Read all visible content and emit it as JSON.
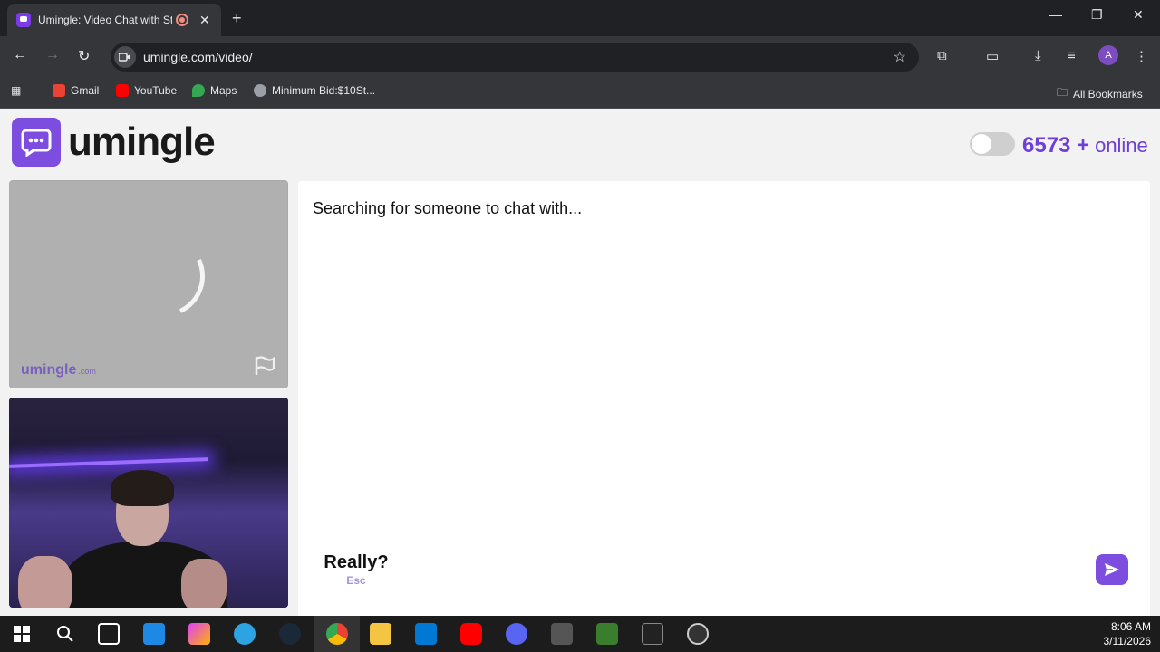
{
  "browser": {
    "tab_title": "Umingle: Video Chat with Strangers",
    "url": "umingle.com/video/",
    "bookmarks": [
      "Gmail",
      "YouTube",
      "Maps",
      "Minimum Bid:$10St..."
    ],
    "all_bookmarks": "All Bookmarks",
    "profile_initial": "A"
  },
  "header": {
    "logo_text": "umingle",
    "online_count": "6573 +",
    "online_label": "online"
  },
  "stranger_video": {
    "watermark_main": "umingle",
    "watermark_domain": ".com"
  },
  "chat": {
    "status": "Searching for someone to chat with..."
  },
  "controls": {
    "esc_label": "Really?",
    "esc_hint": "Esc",
    "message_placeholder": ""
  },
  "taskbar": {
    "time": "8:06 AM",
    "date": "3/11/2026"
  },
  "colors": {
    "brand": "#7c4ddf",
    "online": "#6d3fd6"
  }
}
